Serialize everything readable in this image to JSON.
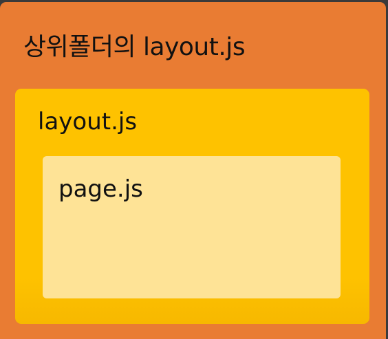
{
  "colors": {
    "outer": "#e97c33",
    "middle": "#fec200",
    "inner": "#fee396"
  },
  "outer": {
    "label": "상위폴더의 layout.js"
  },
  "middle": {
    "label": "layout.js"
  },
  "inner": {
    "label": "page.js"
  }
}
